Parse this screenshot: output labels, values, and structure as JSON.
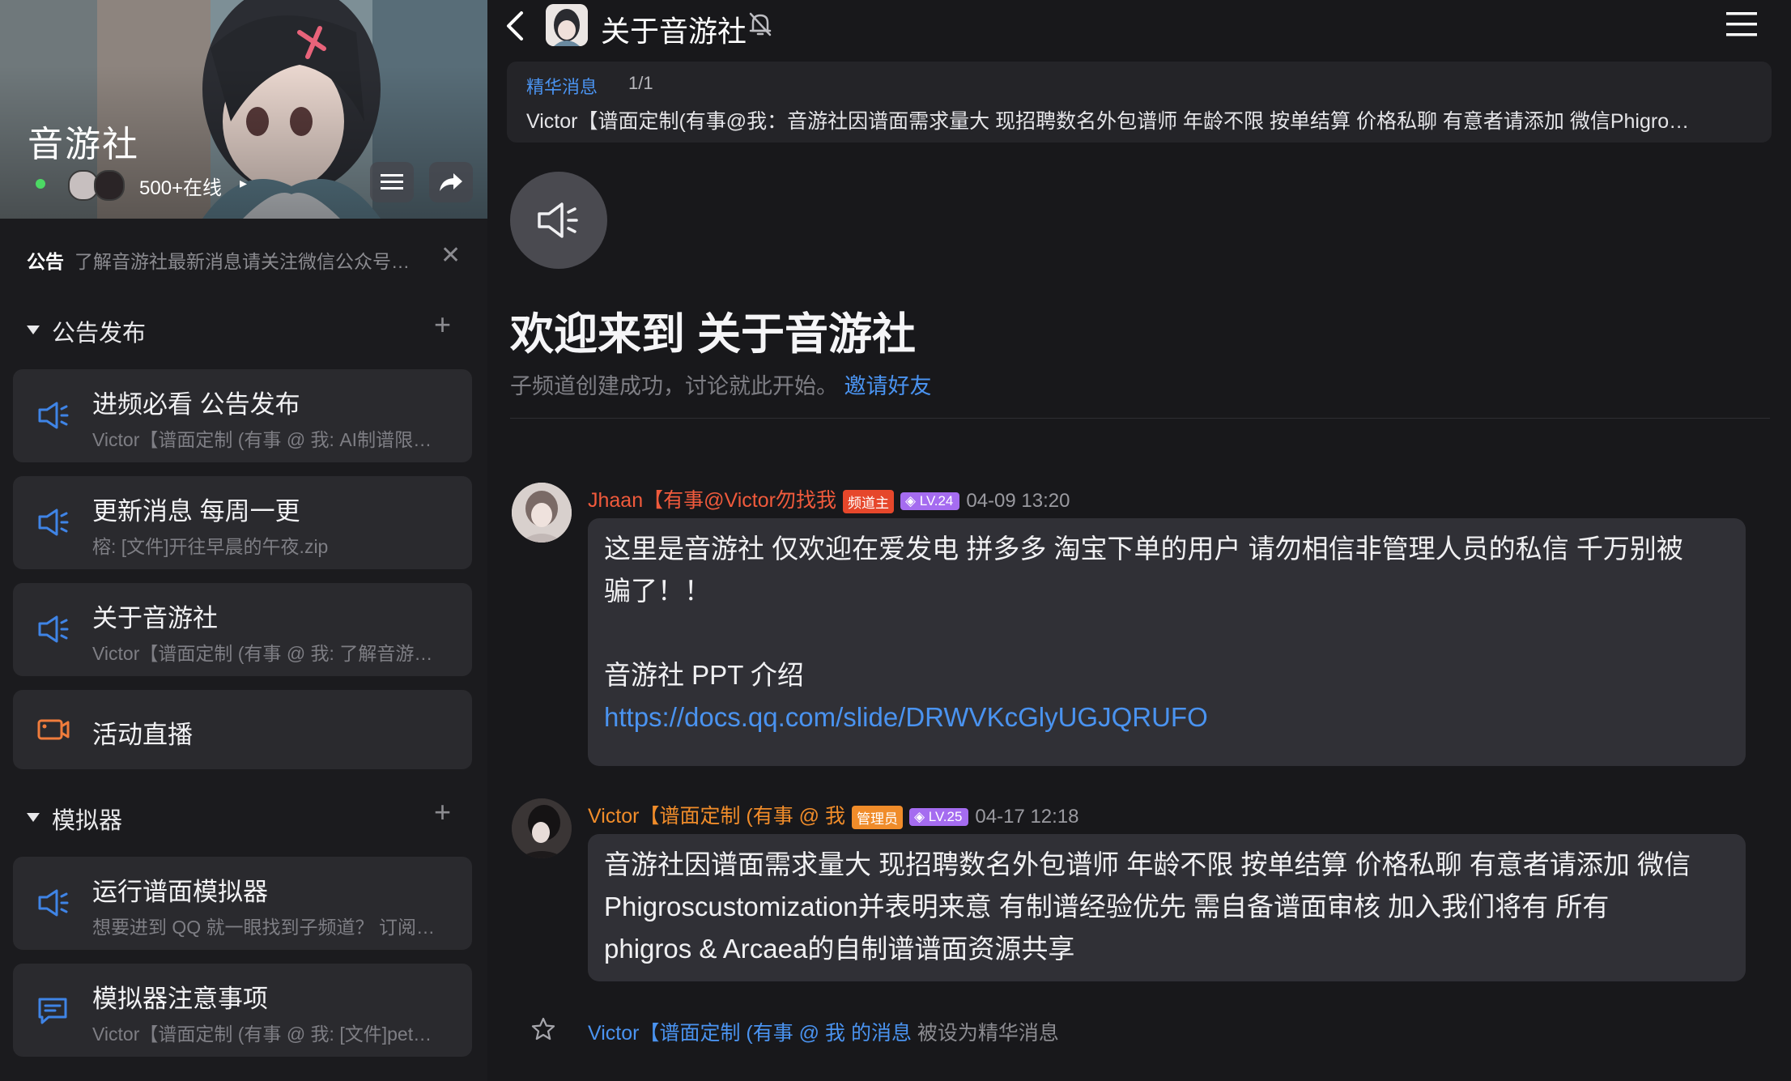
{
  "sidebar": {
    "guild_name": "音游社",
    "online_text": "500+在线",
    "notice_label": "公告",
    "notice_text": "了解音游社最新消息请关注微信公众号…",
    "categories": [
      {
        "label": "公告发布"
      },
      {
        "label": "模拟器"
      }
    ],
    "channels": [
      {
        "title": "进频必看 公告发布",
        "sub": "Victor【谱面定制 (有事 @ 我: AI制谱限…",
        "icon": "speaker-icon"
      },
      {
        "title": "更新消息 每周一更",
        "sub": "榕: [文件]开往早晨的午夜.zip",
        "icon": "speaker-icon"
      },
      {
        "title": "关于音游社",
        "sub": "Victor【谱面定制 (有事 @ 我: 了解音游…",
        "icon": "speaker-icon"
      },
      {
        "title": "活动直播",
        "sub": "",
        "icon": "live-camera-icon"
      },
      {
        "title": "运行谱面模拟器",
        "sub": "想要进到 QQ 就一眼找到子频道？ 订阅…",
        "icon": "speaker-icon"
      },
      {
        "title": "模拟器注意事项",
        "sub": "Victor【谱面定制 (有事 @ 我: [文件]pet…",
        "icon": "chat-icon"
      }
    ]
  },
  "main": {
    "channel_title": "关于音游社",
    "essence": {
      "label": "精华消息",
      "count": "1/1",
      "text": "Victor【谱面定制(有事@我：音游社因谱面需求量大 现招聘数名外包谱师 年龄不限 按单结算 价格私聊 有意者请添加 微信Phigro…"
    },
    "welcome": {
      "title": "欢迎来到 关于音游社",
      "sub": "子频道创建成功，讨论就此开始。",
      "invite": "邀请好友"
    },
    "messages": [
      {
        "name": "Jhaan【有事@Victor勿找我",
        "role": "频道主",
        "level": "LV.24",
        "time": "04-09 13:20",
        "lines": [
          "这里是音游社 仅欢迎在爱发电 拼多多 淘宝下单的用户 请勿相信非管理人员的私信 千万别被",
          "骗了！！",
          "",
          "音游社 PPT 介绍"
        ],
        "link": "https://docs.qq.com/slide/DRWVKcGlyUGJQRUFO"
      },
      {
        "name": "Victor【谱面定制 (有事 @ 我",
        "role": "管理员",
        "level": "LV.25",
        "time": "04-17 12:18",
        "lines": [
          "音游社因谱面需求量大 现招聘数名外包谱师 年龄不限 按单结算 价格私聊 有意者请添加 微信",
          "Phigroscustomization并表明来意 有制谱经验优先 需自备谱面审核 加入我们将有 所有",
          "phigros & Arcaea的自制谱谱面资源共享"
        ]
      }
    ],
    "system_notice": {
      "name": "Victor【谱面定制 (有事 @ 我 的消息",
      "text": "被设为精华消息"
    }
  },
  "colors": {
    "accent_blue": "#4a93f0",
    "name_red": "#f05a3c",
    "owner_badge": "#e6472b",
    "admin_badge": "#f08c2a",
    "level_badge": "#a56cf0",
    "online_green": "#4cd964"
  }
}
